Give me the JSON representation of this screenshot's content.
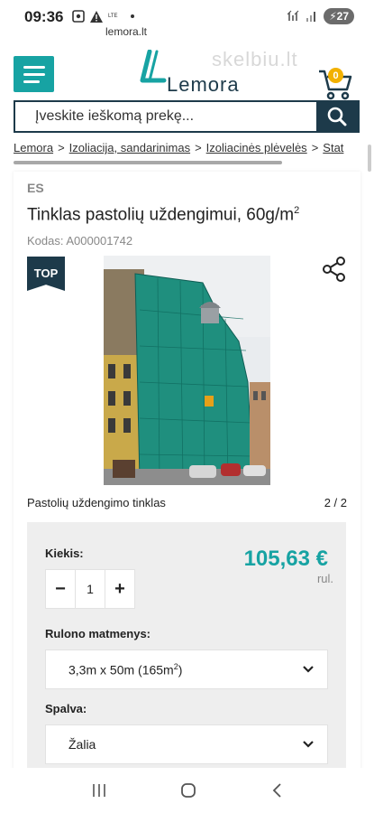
{
  "status_bar": {
    "time": "09:36",
    "network_label": "LTE",
    "battery": "27"
  },
  "browser": {
    "url": "lemora.lt"
  },
  "header": {
    "logo_text": "Lemora",
    "watermark": "skelbiu.lt",
    "cart_count": "0"
  },
  "search": {
    "placeholder": "Įveskite ieškomą prekę..."
  },
  "breadcrumb": [
    "Lemora",
    "Izoliacija, sandarinimas",
    "Izoliacinės plėvelės",
    "Stat"
  ],
  "product": {
    "brand": "ES",
    "title": "Tinklas pastolių uždengimui, 60g/m",
    "title_sup": "2",
    "code": "Kodas: A000001742",
    "top_badge": "TOP",
    "image_caption": "Pastolių uždengimo tinklas",
    "image_pager": "2 / 2"
  },
  "buy": {
    "qty_label": "Kiekis:",
    "qty_value": "1",
    "minus": "−",
    "plus": "+",
    "price": "105,63 €",
    "unit": "rul.",
    "size_label": "Rulono matmenys:",
    "size_value": "3,3m x 50m (165m",
    "size_sup": "2",
    "size_close": ")",
    "color_label": "Spalva:",
    "color_value": "Žalia"
  },
  "colors": {
    "accent": "#17a3a3",
    "dark": "#1d3a4a",
    "badge": "#f2b100"
  },
  "icons": [
    "menu-icon",
    "cart-icon",
    "search-icon",
    "share-icon",
    "chevron-down-icon",
    "nav-recents-icon",
    "nav-home-icon",
    "nav-back-icon"
  ]
}
